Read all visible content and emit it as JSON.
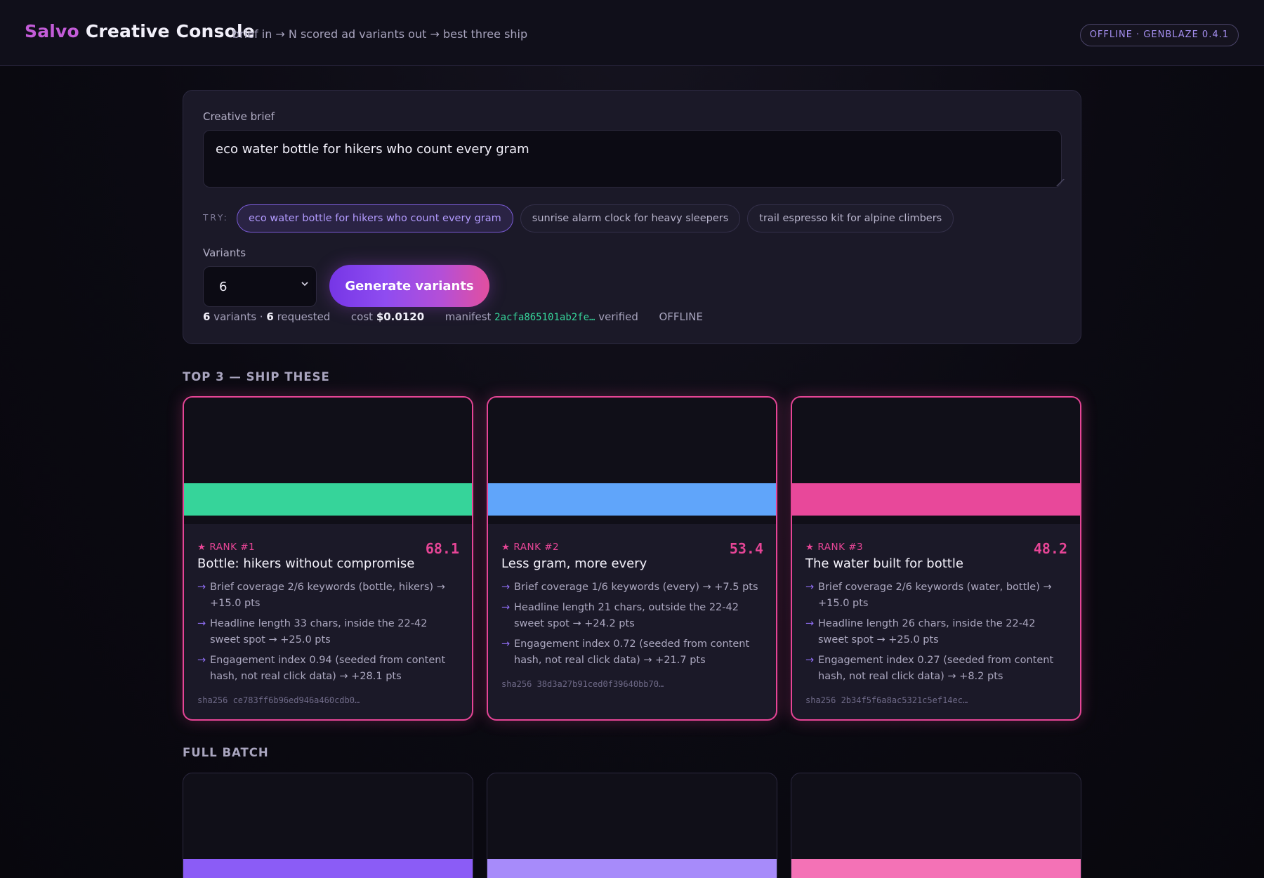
{
  "header": {
    "brand_accent": "Salvo",
    "brand_rest": "Creative Console",
    "tagline": "brief in → N scored ad variants out → best three ship",
    "status_pill": "OFFLINE · GENBLAZE 0.4.1"
  },
  "brief": {
    "label": "Creative brief",
    "value": "eco water bottle for hikers who count every gram",
    "try_label": "TRY:",
    "chips": [
      "eco water bottle for hikers who count every gram",
      "sunrise alarm clock for heavy sleepers",
      "trail espresso kit for alpine climbers"
    ],
    "variants_label": "Variants",
    "variants_value": "6",
    "generate_label": "Generate variants",
    "stats": {
      "variants_count": "6",
      "variants_word": "variants ·",
      "requested_count": "6",
      "requested_word": "requested",
      "cost_label": "cost",
      "cost_value": "$0.0120",
      "manifest_label": "manifest",
      "manifest_hash": "2acfa865101ab2fe…",
      "manifest_status": "verified",
      "mode": "OFFLINE"
    }
  },
  "sections": {
    "top": "TOP 3 — SHIP THESE",
    "batch": "FULL BATCH"
  },
  "top_cards": [
    {
      "rank": "RANK #1",
      "score": "68.1",
      "headline": "Bottle: hikers without compromise",
      "color": "#36d49a",
      "reasons": [
        "Brief coverage 2/6 keywords (bottle, hikers) → +15.0 pts",
        "Headline length 33 chars, inside the 22-42 sweet spot → +25.0 pts",
        "Engagement index 0.94 (seeded from content hash, not real click data) → +28.1 pts"
      ],
      "sha": "sha256 ce783ff6b96ed946a460cdb0…"
    },
    {
      "rank": "RANK #2",
      "score": "53.4",
      "headline": "Less gram, more every",
      "color": "#60a5fa",
      "reasons": [
        "Brief coverage 1/6 keywords (every) → +7.5 pts",
        "Headline length 21 chars, outside the 22-42 sweet spot → +24.2 pts",
        "Engagement index 0.72 (seeded from content hash, not real click data) → +21.7 pts"
      ],
      "sha": "sha256 38d3a27b91ced0f39640bb70…"
    },
    {
      "rank": "RANK #3",
      "score": "48.2",
      "headline": "The water built for bottle",
      "color": "#e8489a",
      "reasons": [
        "Brief coverage 2/6 keywords (water, bottle) → +15.0 pts",
        "Headline length 26 chars, inside the 22-42 sweet spot → +25.0 pts",
        "Engagement index 0.27 (seeded from content hash, not real click data) → +8.2 pts"
      ],
      "sha": "sha256 2b34f5f6a8ac5321c5ef14ec…"
    }
  ],
  "batch_cards": [
    {
      "color": "#8b5cf6"
    },
    {
      "color": "#a78bfa"
    },
    {
      "color": "#f472b6"
    }
  ],
  "icons": {
    "arrow": "arrow-right-icon",
    "star": "star-icon",
    "chevron": "chevron-down-icon"
  }
}
